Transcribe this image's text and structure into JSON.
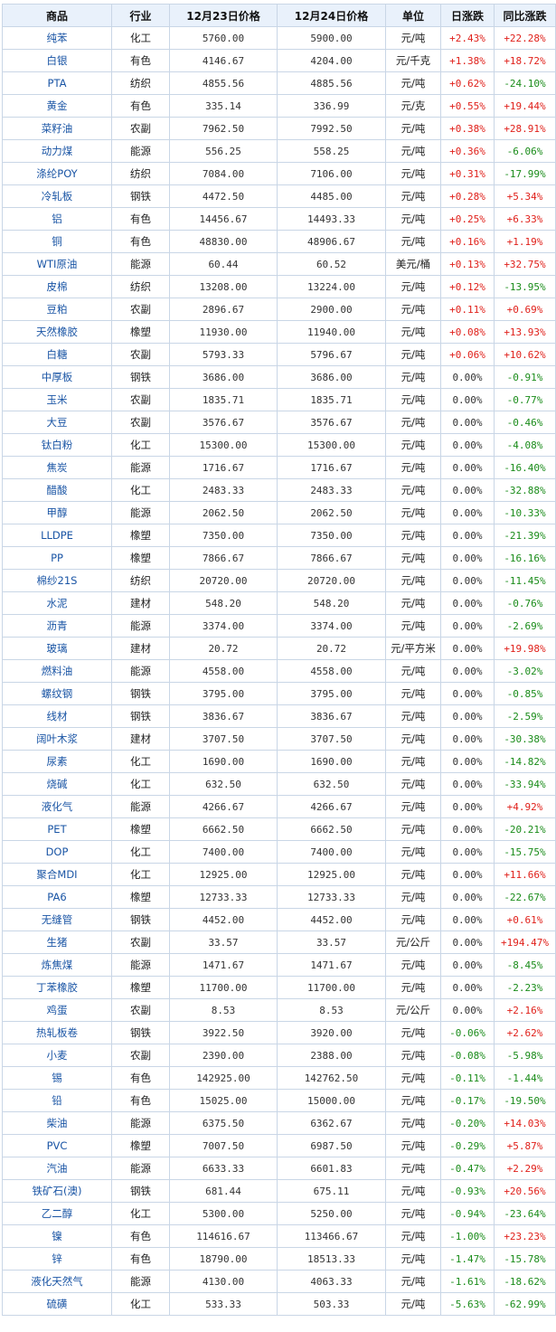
{
  "headers": [
    "商品",
    "行业",
    "12月23日价格",
    "12月24日价格",
    "单位",
    "日涨跌",
    "同比涨跌"
  ],
  "colors": {
    "up": "#e0201a",
    "down": "#1a8c1a",
    "flat": "#333333",
    "link": "#1a55a5",
    "header_bg": "#e9f1fb",
    "border": "#c9d6e6"
  },
  "rows": [
    {
      "name": "纯苯",
      "sector": "化工",
      "p1": "5760.00",
      "p2": "5900.00",
      "unit": "元/吨",
      "day": "+2.43%",
      "yoy": "+22.28%"
    },
    {
      "name": "白银",
      "sector": "有色",
      "p1": "4146.67",
      "p2": "4204.00",
      "unit": "元/千克",
      "day": "+1.38%",
      "yoy": "+18.72%"
    },
    {
      "name": "PTA",
      "sector": "纺织",
      "p1": "4855.56",
      "p2": "4885.56",
      "unit": "元/吨",
      "day": "+0.62%",
      "yoy": "-24.10%"
    },
    {
      "name": "黄金",
      "sector": "有色",
      "p1": "335.14",
      "p2": "336.99",
      "unit": "元/克",
      "day": "+0.55%",
      "yoy": "+19.44%"
    },
    {
      "name": "菜籽油",
      "sector": "农副",
      "p1": "7962.50",
      "p2": "7992.50",
      "unit": "元/吨",
      "day": "+0.38%",
      "yoy": "+28.91%"
    },
    {
      "name": "动力煤",
      "sector": "能源",
      "p1": "556.25",
      "p2": "558.25",
      "unit": "元/吨",
      "day": "+0.36%",
      "yoy": "-6.06%"
    },
    {
      "name": "涤纶POY",
      "sector": "纺织",
      "p1": "7084.00",
      "p2": "7106.00",
      "unit": "元/吨",
      "day": "+0.31%",
      "yoy": "-17.99%"
    },
    {
      "name": "冷轧板",
      "sector": "钢铁",
      "p1": "4472.50",
      "p2": "4485.00",
      "unit": "元/吨",
      "day": "+0.28%",
      "yoy": "+5.34%"
    },
    {
      "name": "铝",
      "sector": "有色",
      "p1": "14456.67",
      "p2": "14493.33",
      "unit": "元/吨",
      "day": "+0.25%",
      "yoy": "+6.33%"
    },
    {
      "name": "铜",
      "sector": "有色",
      "p1": "48830.00",
      "p2": "48906.67",
      "unit": "元/吨",
      "day": "+0.16%",
      "yoy": "+1.19%"
    },
    {
      "name": "WTI原油",
      "sector": "能源",
      "p1": "60.44",
      "p2": "60.52",
      "unit": "美元/桶",
      "day": "+0.13%",
      "yoy": "+32.75%"
    },
    {
      "name": "皮棉",
      "sector": "纺织",
      "p1": "13208.00",
      "p2": "13224.00",
      "unit": "元/吨",
      "day": "+0.12%",
      "yoy": "-13.95%"
    },
    {
      "name": "豆粕",
      "sector": "农副",
      "p1": "2896.67",
      "p2": "2900.00",
      "unit": "元/吨",
      "day": "+0.11%",
      "yoy": "+0.69%"
    },
    {
      "name": "天然橡胶",
      "sector": "橡塑",
      "p1": "11930.00",
      "p2": "11940.00",
      "unit": "元/吨",
      "day": "+0.08%",
      "yoy": "+13.93%"
    },
    {
      "name": "白糖",
      "sector": "农副",
      "p1": "5793.33",
      "p2": "5796.67",
      "unit": "元/吨",
      "day": "+0.06%",
      "yoy": "+10.62%"
    },
    {
      "name": "中厚板",
      "sector": "钢铁",
      "p1": "3686.00",
      "p2": "3686.00",
      "unit": "元/吨",
      "day": "0.00%",
      "yoy": "-0.91%"
    },
    {
      "name": "玉米",
      "sector": "农副",
      "p1": "1835.71",
      "p2": "1835.71",
      "unit": "元/吨",
      "day": "0.00%",
      "yoy": "-0.77%"
    },
    {
      "name": "大豆",
      "sector": "农副",
      "p1": "3576.67",
      "p2": "3576.67",
      "unit": "元/吨",
      "day": "0.00%",
      "yoy": "-0.46%"
    },
    {
      "name": "钛白粉",
      "sector": "化工",
      "p1": "15300.00",
      "p2": "15300.00",
      "unit": "元/吨",
      "day": "0.00%",
      "yoy": "-4.08%"
    },
    {
      "name": "焦炭",
      "sector": "能源",
      "p1": "1716.67",
      "p2": "1716.67",
      "unit": "元/吨",
      "day": "0.00%",
      "yoy": "-16.40%"
    },
    {
      "name": "醋酸",
      "sector": "化工",
      "p1": "2483.33",
      "p2": "2483.33",
      "unit": "元/吨",
      "day": "0.00%",
      "yoy": "-32.88%"
    },
    {
      "name": "甲醇",
      "sector": "能源",
      "p1": "2062.50",
      "p2": "2062.50",
      "unit": "元/吨",
      "day": "0.00%",
      "yoy": "-10.33%"
    },
    {
      "name": "LLDPE",
      "sector": "橡塑",
      "p1": "7350.00",
      "p2": "7350.00",
      "unit": "元/吨",
      "day": "0.00%",
      "yoy": "-21.39%"
    },
    {
      "name": "PP",
      "sector": "橡塑",
      "p1": "7866.67",
      "p2": "7866.67",
      "unit": "元/吨",
      "day": "0.00%",
      "yoy": "-16.16%"
    },
    {
      "name": "棉纱21S",
      "sector": "纺织",
      "p1": "20720.00",
      "p2": "20720.00",
      "unit": "元/吨",
      "day": "0.00%",
      "yoy": "-11.45%"
    },
    {
      "name": "水泥",
      "sector": "建材",
      "p1": "548.20",
      "p2": "548.20",
      "unit": "元/吨",
      "day": "0.00%",
      "yoy": "-0.76%"
    },
    {
      "name": "沥青",
      "sector": "能源",
      "p1": "3374.00",
      "p2": "3374.00",
      "unit": "元/吨",
      "day": "0.00%",
      "yoy": "-2.69%"
    },
    {
      "name": "玻璃",
      "sector": "建材",
      "p1": "20.72",
      "p2": "20.72",
      "unit": "元/平方米",
      "day": "0.00%",
      "yoy": "+19.98%"
    },
    {
      "name": "燃料油",
      "sector": "能源",
      "p1": "4558.00",
      "p2": "4558.00",
      "unit": "元/吨",
      "day": "0.00%",
      "yoy": "-3.02%"
    },
    {
      "name": "螺纹钢",
      "sector": "钢铁",
      "p1": "3795.00",
      "p2": "3795.00",
      "unit": "元/吨",
      "day": "0.00%",
      "yoy": "-0.85%"
    },
    {
      "name": "线材",
      "sector": "钢铁",
      "p1": "3836.67",
      "p2": "3836.67",
      "unit": "元/吨",
      "day": "0.00%",
      "yoy": "-2.59%"
    },
    {
      "name": "阔叶木浆",
      "sector": "建材",
      "p1": "3707.50",
      "p2": "3707.50",
      "unit": "元/吨",
      "day": "0.00%",
      "yoy": "-30.38%"
    },
    {
      "name": "尿素",
      "sector": "化工",
      "p1": "1690.00",
      "p2": "1690.00",
      "unit": "元/吨",
      "day": "0.00%",
      "yoy": "-14.82%"
    },
    {
      "name": "烧碱",
      "sector": "化工",
      "p1": "632.50",
      "p2": "632.50",
      "unit": "元/吨",
      "day": "0.00%",
      "yoy": "-33.94%"
    },
    {
      "name": "液化气",
      "sector": "能源",
      "p1": "4266.67",
      "p2": "4266.67",
      "unit": "元/吨",
      "day": "0.00%",
      "yoy": "+4.92%"
    },
    {
      "name": "PET",
      "sector": "橡塑",
      "p1": "6662.50",
      "p2": "6662.50",
      "unit": "元/吨",
      "day": "0.00%",
      "yoy": "-20.21%"
    },
    {
      "name": "DOP",
      "sector": "化工",
      "p1": "7400.00",
      "p2": "7400.00",
      "unit": "元/吨",
      "day": "0.00%",
      "yoy": "-15.75%"
    },
    {
      "name": "聚合MDI",
      "sector": "化工",
      "p1": "12925.00",
      "p2": "12925.00",
      "unit": "元/吨",
      "day": "0.00%",
      "yoy": "+11.66%"
    },
    {
      "name": "PA6",
      "sector": "橡塑",
      "p1": "12733.33",
      "p2": "12733.33",
      "unit": "元/吨",
      "day": "0.00%",
      "yoy": "-22.67%"
    },
    {
      "name": "无缝管",
      "sector": "钢铁",
      "p1": "4452.00",
      "p2": "4452.00",
      "unit": "元/吨",
      "day": "0.00%",
      "yoy": "+0.61%"
    },
    {
      "name": "生猪",
      "sector": "农副",
      "p1": "33.57",
      "p2": "33.57",
      "unit": "元/公斤",
      "day": "0.00%",
      "yoy": "+194.47%"
    },
    {
      "name": "炼焦煤",
      "sector": "能源",
      "p1": "1471.67",
      "p2": "1471.67",
      "unit": "元/吨",
      "day": "0.00%",
      "yoy": "-8.45%"
    },
    {
      "name": "丁苯橡胶",
      "sector": "橡塑",
      "p1": "11700.00",
      "p2": "11700.00",
      "unit": "元/吨",
      "day": "0.00%",
      "yoy": "-2.23%"
    },
    {
      "name": "鸡蛋",
      "sector": "农副",
      "p1": "8.53",
      "p2": "8.53",
      "unit": "元/公斤",
      "day": "0.00%",
      "yoy": "+2.16%"
    },
    {
      "name": "热轧板卷",
      "sector": "钢铁",
      "p1": "3922.50",
      "p2": "3920.00",
      "unit": "元/吨",
      "day": "-0.06%",
      "yoy": "+2.62%"
    },
    {
      "name": "小麦",
      "sector": "农副",
      "p1": "2390.00",
      "p2": "2388.00",
      "unit": "元/吨",
      "day": "-0.08%",
      "yoy": "-5.98%"
    },
    {
      "name": "锡",
      "sector": "有色",
      "p1": "142925.00",
      "p2": "142762.50",
      "unit": "元/吨",
      "day": "-0.11%",
      "yoy": "-1.44%"
    },
    {
      "name": "铅",
      "sector": "有色",
      "p1": "15025.00",
      "p2": "15000.00",
      "unit": "元/吨",
      "day": "-0.17%",
      "yoy": "-19.50%"
    },
    {
      "name": "柴油",
      "sector": "能源",
      "p1": "6375.50",
      "p2": "6362.67",
      "unit": "元/吨",
      "day": "-0.20%",
      "yoy": "+14.03%"
    },
    {
      "name": "PVC",
      "sector": "橡塑",
      "p1": "7007.50",
      "p2": "6987.50",
      "unit": "元/吨",
      "day": "-0.29%",
      "yoy": "+5.87%"
    },
    {
      "name": "汽油",
      "sector": "能源",
      "p1": "6633.33",
      "p2": "6601.83",
      "unit": "元/吨",
      "day": "-0.47%",
      "yoy": "+2.29%"
    },
    {
      "name": "铁矿石(澳)",
      "sector": "钢铁",
      "p1": "681.44",
      "p2": "675.11",
      "unit": "元/吨",
      "day": "-0.93%",
      "yoy": "+20.56%"
    },
    {
      "name": "乙二醇",
      "sector": "化工",
      "p1": "5300.00",
      "p2": "5250.00",
      "unit": "元/吨",
      "day": "-0.94%",
      "yoy": "-23.64%"
    },
    {
      "name": "镍",
      "sector": "有色",
      "p1": "114616.67",
      "p2": "113466.67",
      "unit": "元/吨",
      "day": "-1.00%",
      "yoy": "+23.23%"
    },
    {
      "name": "锌",
      "sector": "有色",
      "p1": "18790.00",
      "p2": "18513.33",
      "unit": "元/吨",
      "day": "-1.47%",
      "yoy": "-15.78%"
    },
    {
      "name": "液化天然气",
      "sector": "能源",
      "p1": "4130.00",
      "p2": "4063.33",
      "unit": "元/吨",
      "day": "-1.61%",
      "yoy": "-18.62%"
    },
    {
      "name": "硫磺",
      "sector": "化工",
      "p1": "533.33",
      "p2": "503.33",
      "unit": "元/吨",
      "day": "-5.63%",
      "yoy": "-62.99%"
    }
  ]
}
